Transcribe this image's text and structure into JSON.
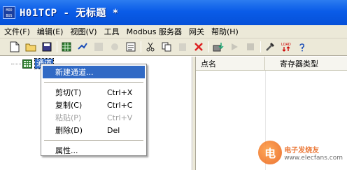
{
  "window": {
    "icon_text": "MOD\nBUS",
    "title": "H01TCP - 无标题 *"
  },
  "menubar": [
    {
      "name": "menu-file",
      "label": "文件(F)"
    },
    {
      "name": "menu-edit",
      "label": "编辑(E)"
    },
    {
      "name": "menu-view",
      "label": "视图(V)"
    },
    {
      "name": "menu-tools",
      "label": "工具"
    },
    {
      "name": "menu-modbus-server",
      "label": "Modbus 服务器"
    },
    {
      "name": "menu-gateway",
      "label": "网关"
    },
    {
      "name": "menu-help",
      "label": "帮助(H)"
    }
  ],
  "toolbar": {
    "icons": [
      "new-file-icon",
      "open-folder-icon",
      "save-icon",
      "separator",
      "device-icon",
      "connect-icon",
      "grid-icon",
      "gear-icon",
      "properties-icon",
      "separator",
      "cut-icon",
      "copy-icon",
      "paste-icon",
      "delete-icon",
      "separator",
      "download-icon",
      "run-icon",
      "stop-icon",
      "separator",
      "tools-icon",
      "load-icon",
      "help-icon"
    ]
  },
  "tree": {
    "root_label": "通道"
  },
  "list": {
    "columns": [
      "点名",
      "寄存器类型"
    ]
  },
  "context_menu": {
    "items": [
      {
        "label": "新建通道...",
        "shortcut": "",
        "highlight": true,
        "enabled": true
      },
      {
        "separator": true
      },
      {
        "label": "剪切(T)",
        "shortcut": "Ctrl+X",
        "enabled": true
      },
      {
        "label": "复制(C)",
        "shortcut": "Ctrl+C",
        "enabled": true
      },
      {
        "label": "粘贴(P)",
        "shortcut": "Ctrl+V",
        "enabled": false
      },
      {
        "label": "删除(D)",
        "shortcut": "Del",
        "enabled": true
      },
      {
        "separator": true
      },
      {
        "label": "属性...",
        "shortcut": "",
        "enabled": true
      }
    ]
  },
  "watermark": {
    "logo": "电",
    "top": "电子发烧友",
    "bottom": "www.elecfans.com"
  },
  "colors": {
    "titlebar": "#0a5ce8",
    "highlight": "#316ac5",
    "chrome": "#ece9d8"
  }
}
